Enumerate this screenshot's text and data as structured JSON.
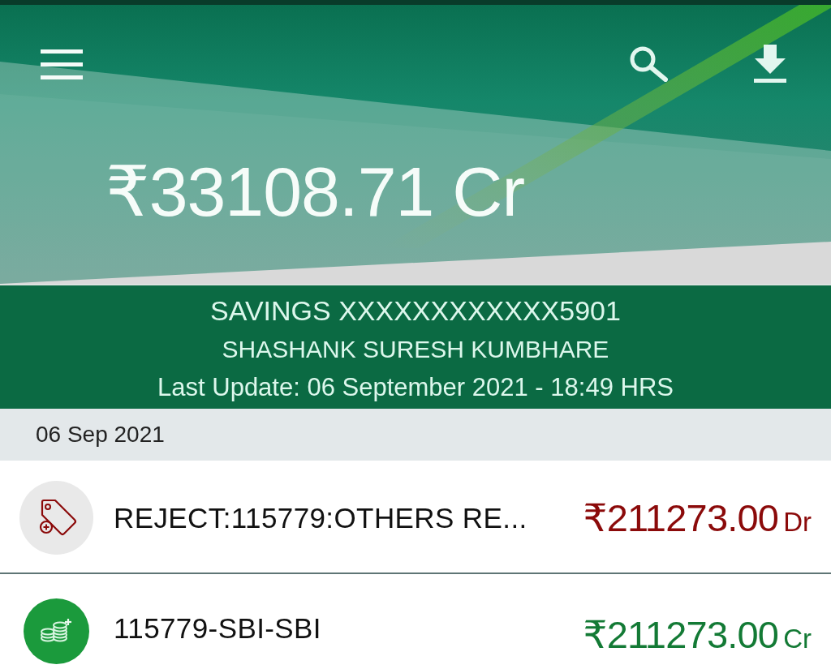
{
  "header": {
    "balance": "₹33108.71 Cr"
  },
  "account": {
    "number": "SAVINGS XXXXXXXXXXXX5901",
    "holder": "SHASHANK SURESH KUMBHARE",
    "last_update": "Last Update: 06 September 2021 - 18:49 HRS"
  },
  "date_groups": [
    {
      "date": "06 Sep 2021",
      "transactions": [
        {
          "kind": "debit",
          "description": "REJECT:115779:OTHERS RE...",
          "amount": "₹211273.00",
          "suffix": "Dr"
        },
        {
          "kind": "credit",
          "description": "115779-SBI-SBI",
          "amount": "₹211273.00",
          "suffix": "Cr"
        }
      ]
    }
  ]
}
